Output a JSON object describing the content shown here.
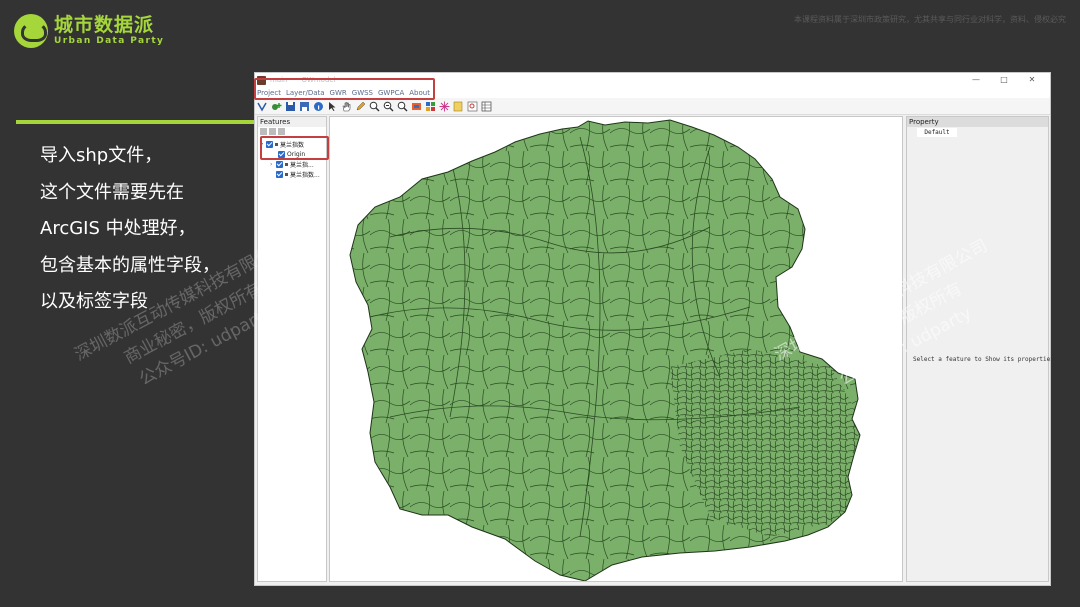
{
  "logo": {
    "cn": "城市数据派",
    "en": "Urban Data Party"
  },
  "copyright": "本课程资料属于深圳市政策研究，尤其共享与同行业对科学，资料、侵权必究",
  "bullets": [
    "导入shp文件，",
    "这个文件需要先在",
    "ArcGIS 中处理好，",
    "包含基本的属性字段，",
    "以及标签字段"
  ],
  "window": {
    "title": "main",
    "title_suffix": "GWmodel",
    "controls": [
      "—",
      "□",
      "✕"
    ],
    "menu": [
      "Project",
      "Layer/Data",
      "GWR",
      "GWSS",
      "GWPCA",
      "About"
    ]
  },
  "features_panel": {
    "title": "Features",
    "items": [
      {
        "label": "莫兰指数",
        "level": 0
      },
      {
        "label": "Origin",
        "level": 1
      },
      {
        "label": "莫兰指...",
        "level": 1
      },
      {
        "label": "莫兰指数...",
        "level": 1
      }
    ]
  },
  "property_panel": {
    "title": "Property",
    "tab": "Default",
    "message": "Select a feature to Show its properties."
  },
  "watermark": {
    "lines": [
      "深圳数派互动传媒科技有限公司",
      "商业秘密，版权所有",
      "公众号ID: udparty"
    ]
  },
  "colors": {
    "accent": "#a5d63a",
    "map_fill": "#7ab06a",
    "highlight": "#c44040",
    "background": "#333333"
  }
}
